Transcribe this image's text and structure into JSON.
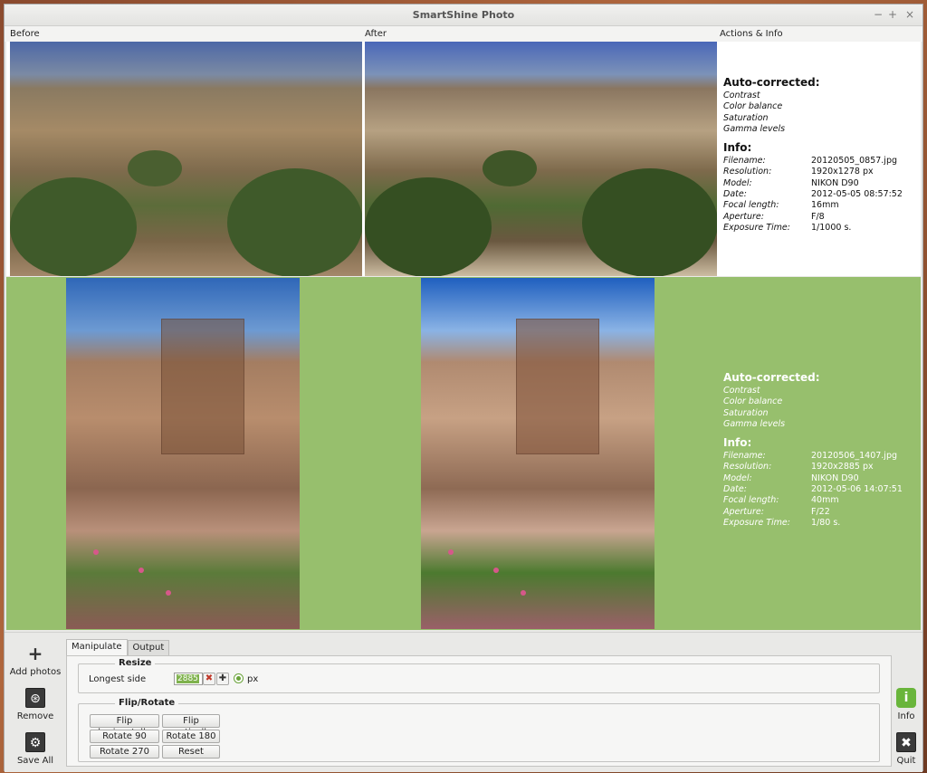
{
  "window": {
    "title": "SmartShine Photo",
    "minimize": "−",
    "maximize": "+",
    "close": "×"
  },
  "columns": {
    "before": "Before",
    "after": "After",
    "actions": "Actions & Info"
  },
  "photos": [
    {
      "auto_corrected_title": "Auto-corrected:",
      "corrections": [
        "Contrast",
        "Color balance",
        "Saturation",
        "Gamma levels"
      ],
      "info_title": "Info:",
      "info": [
        {
          "key": "Filename:",
          "value": "20120505_0857.jpg"
        },
        {
          "key": "Resolution:",
          "value": "1920x1278 px"
        },
        {
          "key": "Model:",
          "value": "NIKON D90"
        },
        {
          "key": "Date:",
          "value": "2012-05-05 08:57:52"
        },
        {
          "key": "Focal length:",
          "value": "16mm"
        },
        {
          "key": "Aperture:",
          "value": "F/8"
        },
        {
          "key": "Exposure Time:",
          "value": "1/1000 s."
        }
      ]
    },
    {
      "auto_corrected_title": "Auto-corrected:",
      "corrections": [
        "Contrast",
        "Color balance",
        "Saturation",
        "Gamma levels"
      ],
      "info_title": "Info:",
      "info": [
        {
          "key": "Filename:",
          "value": "20120506_1407.jpg"
        },
        {
          "key": "Resolution:",
          "value": "1920x2885 px"
        },
        {
          "key": "Model:",
          "value": "NIKON D90"
        },
        {
          "key": "Date:",
          "value": "2012-05-06 14:07:51"
        },
        {
          "key": "Focal length:",
          "value": "40mm"
        },
        {
          "key": "Aperture:",
          "value": "F/22"
        },
        {
          "key": "Exposure Time:",
          "value": "1/80 s."
        }
      ]
    }
  ],
  "left_toolbar": {
    "add_photos": "Add photos",
    "remove": "Remove",
    "save_all": "Save All",
    "add_icon": "plus-icon",
    "remove_icon": "remove-icon",
    "save_icon": "gear-icon"
  },
  "right_toolbar": {
    "info": "Info",
    "quit": "Quit",
    "info_icon": "info-icon",
    "quit_icon": "close-icon"
  },
  "tabs": [
    "Manipulate",
    "Output"
  ],
  "resize": {
    "legend": "Resize",
    "longest_side_label": "Longest side",
    "longest_side_value": "2885",
    "unit": "px",
    "clear_glyph": "✖",
    "add_glyph": "✚"
  },
  "flip_rotate": {
    "legend": "Flip/Rotate",
    "flip_horizontally": "Flip horizontally",
    "flip_vertically": "Flip vertically",
    "rotate_90": "Rotate 90",
    "rotate_180": "Rotate 180",
    "rotate_270": "Rotate 270",
    "reset": "Reset"
  },
  "colors": {
    "selected_row": "#97bf6d",
    "accent": "#69b53b"
  }
}
